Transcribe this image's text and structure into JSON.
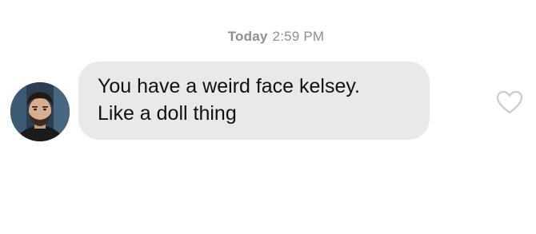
{
  "timestamp": {
    "day": "Today",
    "time": "2:59 PM"
  },
  "message": {
    "line1": "You have a weird face kelsey.",
    "line2": "Like a doll thing",
    "bubble_color": "#e9e9eb"
  },
  "icons": {
    "avatar": "avatar-photo",
    "like": "heart-outline-icon"
  }
}
